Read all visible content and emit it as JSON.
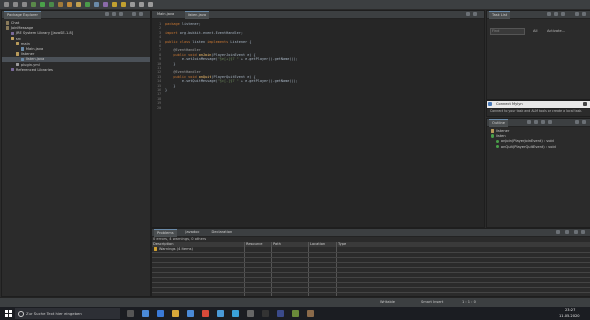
{
  "toolbar": {
    "buttons": [
      "new",
      "save",
      "print",
      "debug",
      "run",
      "coverage",
      "external-tools",
      "new-java-project",
      "new-package",
      "new-class",
      "open-type",
      "search",
      "next-annotation",
      "prev-annotation",
      "back",
      "forward",
      "pin"
    ]
  },
  "package_explorer": {
    "title": "Package Explorer",
    "tree": [
      {
        "label": "Chat",
        "depth": 0,
        "icon": "project-icon"
      },
      {
        "label": "JoinMessage",
        "depth": 0,
        "icon": "project-icon"
      },
      {
        "label": "JRE System Library [JavaSE-1.8]",
        "depth": 1,
        "icon": "library-icon"
      },
      {
        "label": "src",
        "depth": 1,
        "icon": "source-folder-icon"
      },
      {
        "label": "main",
        "depth": 2,
        "icon": "package-icon"
      },
      {
        "label": "Main.java",
        "depth": 3,
        "icon": "java-file-icon"
      },
      {
        "label": "listener",
        "depth": 2,
        "icon": "package-icon"
      },
      {
        "label": "listen.java",
        "depth": 3,
        "icon": "java-file-icon",
        "selected": true
      },
      {
        "label": "plugin.yml",
        "depth": 2,
        "icon": "yml-file-icon"
      },
      {
        "label": "Referenced Libraries",
        "depth": 1,
        "icon": "library-icon"
      }
    ]
  },
  "editor": {
    "tabs": [
      {
        "label": "Main.java",
        "active": false
      },
      {
        "label": "listen.java",
        "active": true
      }
    ],
    "line_numbers": [
      "1",
      "2",
      "3",
      "4",
      "5",
      "6",
      "7",
      "8",
      "9",
      "10",
      "11",
      "12",
      "13",
      "14",
      "15",
      "16",
      "17",
      "18",
      "19",
      "20"
    ],
    "lines": [
      [
        {
          "t": "package ",
          "c": "kw"
        },
        {
          "t": "listener;",
          "c": "cls"
        }
      ],
      [],
      [
        {
          "t": "import ",
          "c": "kw"
        },
        {
          "t": "org.bukkit.event.EventHandler;",
          "c": "cls"
        }
      ],
      [],
      [
        {
          "t": "public class ",
          "c": "kw"
        },
        {
          "t": "listen ",
          "c": "cls"
        },
        {
          "t": "implements ",
          "c": "kw"
        },
        {
          "t": "Listener {",
          "c": "cls"
        }
      ],
      [],
      [
        {
          "t": "    @EventHandler",
          "c": "ann"
        }
      ],
      [
        {
          "t": "    public void ",
          "c": "kw"
        },
        {
          "t": "onJoin",
          "c": "mth"
        },
        {
          "t": "(PlayerJoinEvent e) {",
          "c": "cls"
        }
      ],
      [
        {
          "t": "        e.setJoinMessage(",
          "c": "cls"
        },
        {
          "t": "\"§e[+]§7 \"",
          "c": "str"
        },
        {
          "t": " + e.getPlayer().getName());",
          "c": "cls"
        }
      ],
      [
        {
          "t": "    }",
          "c": "cls"
        }
      ],
      [],
      [
        {
          "t": "    @EventHandler",
          "c": "ann"
        }
      ],
      [
        {
          "t": "    public void ",
          "c": "kw"
        },
        {
          "t": "onQuit",
          "c": "mth"
        },
        {
          "t": "(PlayerQuitEvent e) {",
          "c": "cls"
        }
      ],
      [
        {
          "t": "        e.setQuitMessage(",
          "c": "cls"
        },
        {
          "t": "\"§c[-]§7 \"",
          "c": "str"
        },
        {
          "t": " + e.getPlayer().getName());",
          "c": "cls"
        }
      ],
      [
        {
          "t": "    }",
          "c": "cls"
        }
      ],
      [
        {
          "t": "}",
          "c": "cls"
        }
      ],
      [],
      [],
      [],
      []
    ]
  },
  "task_list": {
    "title": "Task List",
    "find_placeholder": "Find",
    "filter_all": "All",
    "activate": "Activate..."
  },
  "connect": {
    "title": "Connect Mylyn",
    "text": "Connect to your task and ALM tools or create a local task."
  },
  "outline": {
    "title": "Outline",
    "items": [
      {
        "label": "listener",
        "depth": 0,
        "icon": "package-icon"
      },
      {
        "label": "listen",
        "depth": 0,
        "icon": "class-icon"
      },
      {
        "label": "onJoin(PlayerJoinEvent) : void",
        "depth": 1,
        "icon": "method-icon"
      },
      {
        "label": "onQuit(PlayerQuitEvent) : void",
        "depth": 1,
        "icon": "method-icon"
      }
    ]
  },
  "bottom": {
    "tabs": [
      {
        "label": "Problems",
        "active": true
      },
      {
        "label": "Javadoc",
        "active": false
      },
      {
        "label": "Declaration",
        "active": false
      }
    ],
    "summary": "0 errors, 4 warnings, 0 others",
    "columns": [
      "Description",
      "Resource",
      "Path",
      "Location",
      "Type"
    ],
    "rows": [
      {
        "description": "Warnings (4 items)"
      }
    ]
  },
  "status": {
    "writable": "Writable",
    "insert": "Smart Insert",
    "position": "1 : 1 : 0"
  },
  "taskbar": {
    "search_placeholder": "Zur Suche Text hier eingeben",
    "time": "23:27",
    "date": "11.05.2020",
    "apps": [
      "task-view-icon",
      "chrome-icon",
      "edge-icon",
      "explorer-icon",
      "mail-icon",
      "office-icon",
      "store-icon",
      "skype-icon",
      "calculator-icon",
      "terminal-icon",
      "eclipse-icon",
      "minecraft-icon",
      "app-icon"
    ]
  },
  "colors": {
    "accent": "#6a8aa8",
    "editor_bg": "#2b2b2b",
    "keyword": "#cc7832",
    "string": "#6a8759"
  }
}
